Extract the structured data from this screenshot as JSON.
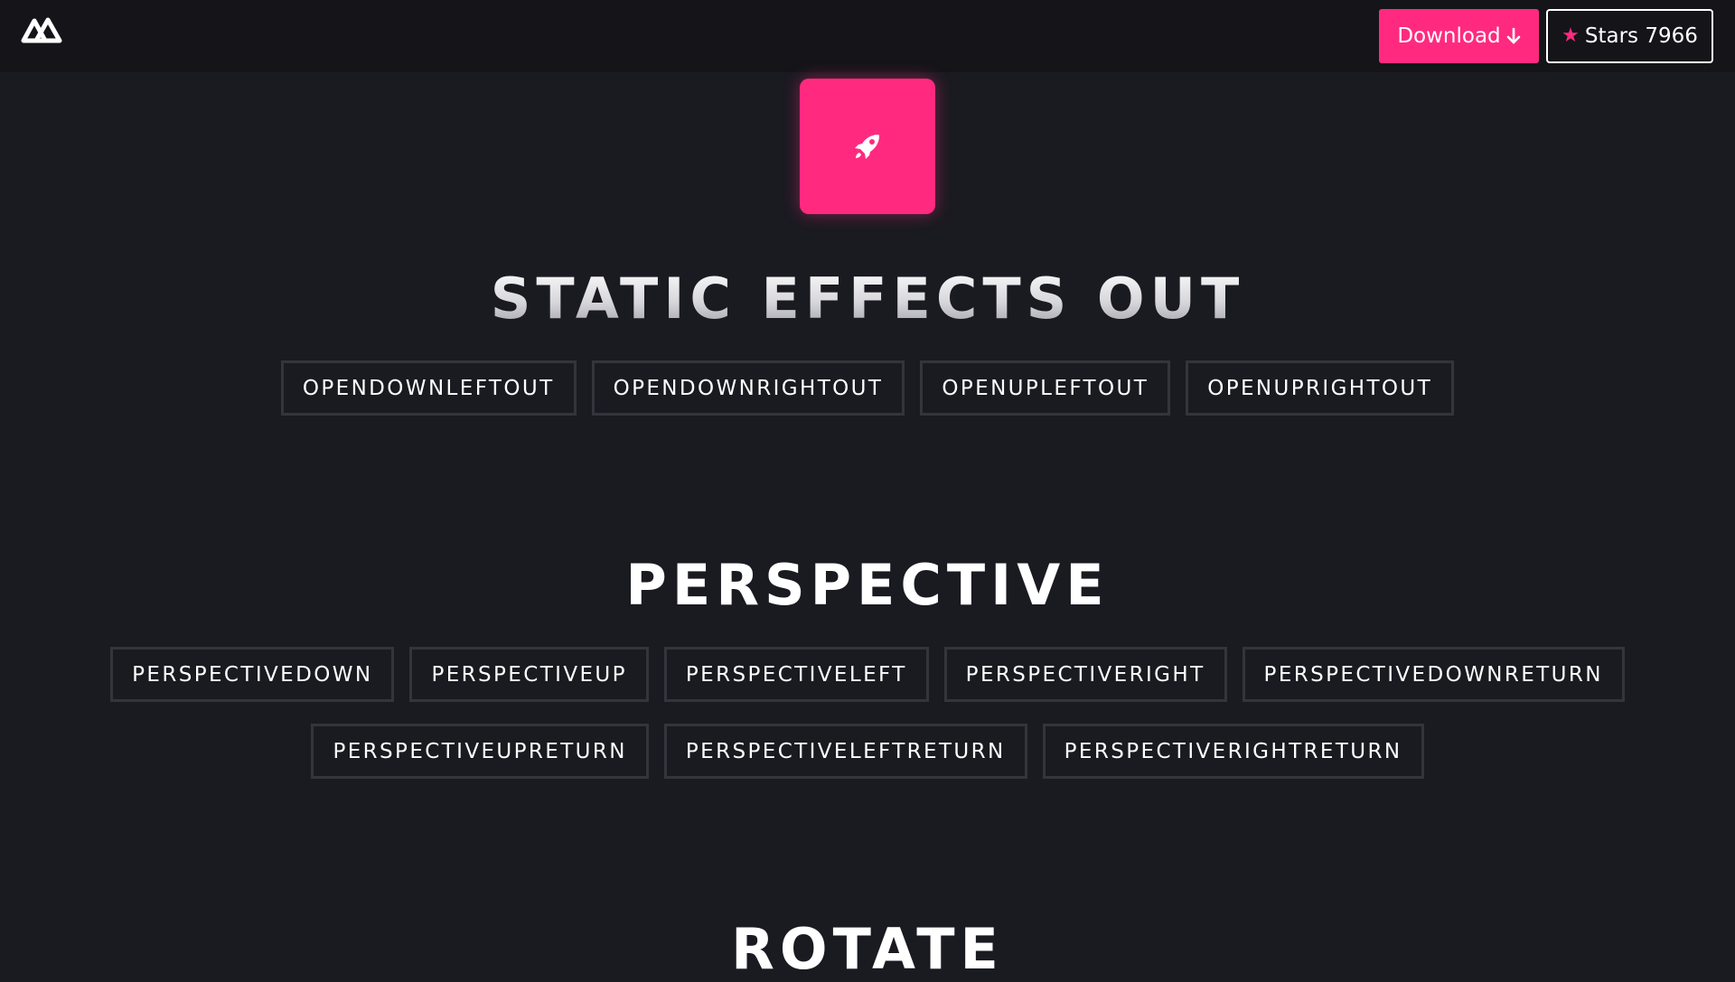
{
  "header": {
    "logo_icon": "nav-logo-icon",
    "download_label": "Download",
    "download_icon": "arrow-down-icon",
    "stars_label": "Stars 7966",
    "star_icon": "star-icon",
    "accent_color": "#ff2a7f"
  },
  "hero": {
    "icon": "rocket-icon"
  },
  "sections": [
    {
      "title": "STATIC EFFECTS OUT",
      "rows": [
        [
          "OPENDOWNLEFTOUT",
          "OPENDOWNRIGHTOUT",
          "OPENUPLEFTOUT",
          "OPENUPRIGHTOUT"
        ]
      ]
    },
    {
      "title": "PERSPECTIVE",
      "rows": [
        [
          "PERSPECTIVEDOWN",
          "PERSPECTIVEUP",
          "PERSPECTIVELEFT",
          "PERSPECTIVERIGHT",
          "PERSPECTIVEDOWNRETURN"
        ],
        [
          "PERSPECTIVEUPRETURN",
          "PERSPECTIVELEFTRETURN",
          "PERSPECTIVERIGHTRETURN"
        ]
      ]
    },
    {
      "title": "ROTATE",
      "rows": []
    }
  ]
}
